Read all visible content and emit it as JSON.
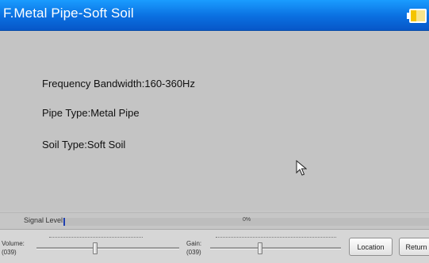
{
  "window": {
    "title": "F.Metal Pipe-Soft Soil",
    "battery_icon": "battery-icon"
  },
  "info": {
    "frequency": "Frequency Bandwidth:160-360Hz",
    "pipe_type": "Pipe Type:Metal Pipe",
    "soil_type": "Soil Type:Soft Soil"
  },
  "signal": {
    "label": "Signal Level:",
    "percent_text": "0%",
    "level": 0
  },
  "volume": {
    "label": "Volume:",
    "value_text": "(039)"
  },
  "gain": {
    "label": "Gain:",
    "value_text": "(039)"
  },
  "buttons": {
    "location": "Location",
    "return": "Return"
  },
  "colors": {
    "titlebar": "#0a6fe0",
    "signal_fill": "#1e3fb0",
    "background": "#c6c6c6"
  }
}
